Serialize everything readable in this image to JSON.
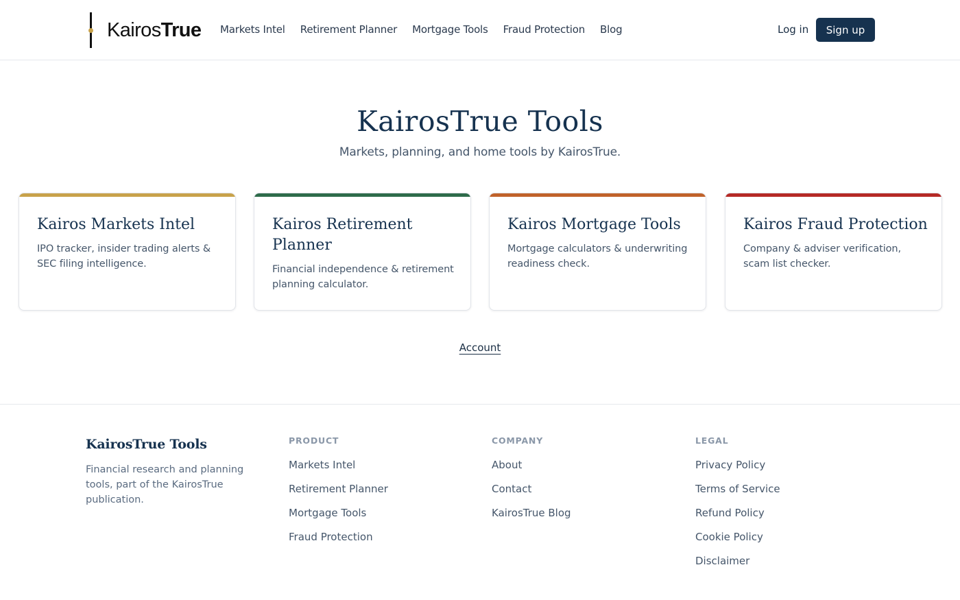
{
  "header": {
    "logo": {
      "light": "Kairos",
      "bold": "True"
    },
    "nav": [
      {
        "label": "Markets Intel"
      },
      {
        "label": "Retirement Planner"
      },
      {
        "label": "Mortgage Tools"
      },
      {
        "label": "Fraud Protection"
      },
      {
        "label": "Blog"
      }
    ],
    "login_label": "Log in",
    "signup_label": "Sign up"
  },
  "hero": {
    "title": "KairosTrue Tools",
    "subtitle": "Markets, planning, and home tools by KairosTrue."
  },
  "cards": [
    {
      "title": "Kairos Markets Intel",
      "description": "IPO tracker, insider trading alerts & SEC filing intelligence.",
      "accent": "#c8a24a"
    },
    {
      "title": "Kairos Retirement Planner",
      "description": "Financial independence & retirement planning calculator.",
      "accent": "#2e6b4a"
    },
    {
      "title": "Kairos Mortgage Tools",
      "description": "Mortgage calculators & underwriting readiness check.",
      "accent": "#c0622a"
    },
    {
      "title": "Kairos Fraud Protection",
      "description": "Company & adviser verification, scam list checker.",
      "accent": "#b52a26"
    }
  ],
  "account_link": "Account",
  "footer": {
    "brand": "KairosTrue Tools",
    "description": "Financial research and planning tools, part of the KairosTrue publication.",
    "columns": [
      {
        "heading": "PRODUCT",
        "links": [
          "Markets Intel",
          "Retirement Planner",
          "Mortgage Tools",
          "Fraud Protection"
        ]
      },
      {
        "heading": "COMPANY",
        "links": [
          "About",
          "Contact",
          "KairosTrue Blog"
        ]
      },
      {
        "heading": "LEGAL",
        "links": [
          "Privacy Policy",
          "Terms of Service",
          "Refund Policy",
          "Cookie Policy",
          "Disclaimer"
        ]
      }
    ]
  },
  "colors": {
    "brand_navy": "#16324f",
    "logo_dot": "#c8a24a"
  }
}
